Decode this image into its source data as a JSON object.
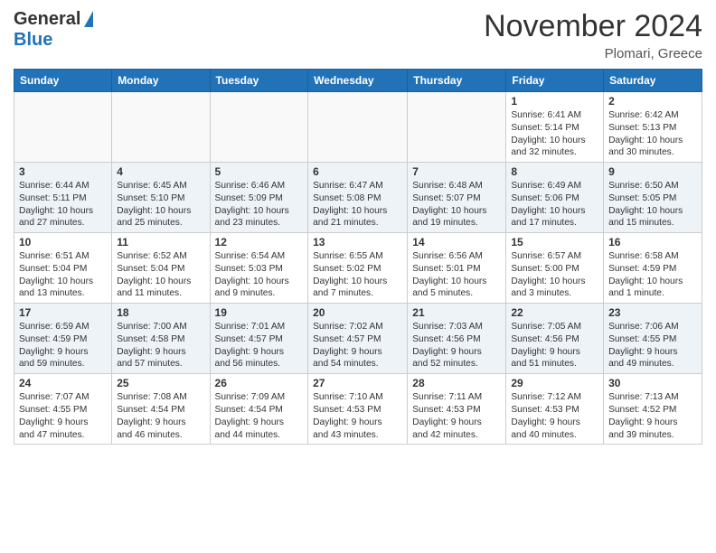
{
  "header": {
    "logo_general": "General",
    "logo_blue": "Blue",
    "month": "November 2024",
    "location": "Plomari, Greece"
  },
  "columns": [
    "Sunday",
    "Monday",
    "Tuesday",
    "Wednesday",
    "Thursday",
    "Friday",
    "Saturday"
  ],
  "rows": [
    [
      {
        "day": "",
        "info": ""
      },
      {
        "day": "",
        "info": ""
      },
      {
        "day": "",
        "info": ""
      },
      {
        "day": "",
        "info": ""
      },
      {
        "day": "",
        "info": ""
      },
      {
        "day": "1",
        "info": "Sunrise: 6:41 AM\nSunset: 5:14 PM\nDaylight: 10 hours\nand 32 minutes."
      },
      {
        "day": "2",
        "info": "Sunrise: 6:42 AM\nSunset: 5:13 PM\nDaylight: 10 hours\nand 30 minutes."
      }
    ],
    [
      {
        "day": "3",
        "info": "Sunrise: 6:44 AM\nSunset: 5:11 PM\nDaylight: 10 hours\nand 27 minutes."
      },
      {
        "day": "4",
        "info": "Sunrise: 6:45 AM\nSunset: 5:10 PM\nDaylight: 10 hours\nand 25 minutes."
      },
      {
        "day": "5",
        "info": "Sunrise: 6:46 AM\nSunset: 5:09 PM\nDaylight: 10 hours\nand 23 minutes."
      },
      {
        "day": "6",
        "info": "Sunrise: 6:47 AM\nSunset: 5:08 PM\nDaylight: 10 hours\nand 21 minutes."
      },
      {
        "day": "7",
        "info": "Sunrise: 6:48 AM\nSunset: 5:07 PM\nDaylight: 10 hours\nand 19 minutes."
      },
      {
        "day": "8",
        "info": "Sunrise: 6:49 AM\nSunset: 5:06 PM\nDaylight: 10 hours\nand 17 minutes."
      },
      {
        "day": "9",
        "info": "Sunrise: 6:50 AM\nSunset: 5:05 PM\nDaylight: 10 hours\nand 15 minutes."
      }
    ],
    [
      {
        "day": "10",
        "info": "Sunrise: 6:51 AM\nSunset: 5:04 PM\nDaylight: 10 hours\nand 13 minutes."
      },
      {
        "day": "11",
        "info": "Sunrise: 6:52 AM\nSunset: 5:04 PM\nDaylight: 10 hours\nand 11 minutes."
      },
      {
        "day": "12",
        "info": "Sunrise: 6:54 AM\nSunset: 5:03 PM\nDaylight: 10 hours\nand 9 minutes."
      },
      {
        "day": "13",
        "info": "Sunrise: 6:55 AM\nSunset: 5:02 PM\nDaylight: 10 hours\nand 7 minutes."
      },
      {
        "day": "14",
        "info": "Sunrise: 6:56 AM\nSunset: 5:01 PM\nDaylight: 10 hours\nand 5 minutes."
      },
      {
        "day": "15",
        "info": "Sunrise: 6:57 AM\nSunset: 5:00 PM\nDaylight: 10 hours\nand 3 minutes."
      },
      {
        "day": "16",
        "info": "Sunrise: 6:58 AM\nSunset: 4:59 PM\nDaylight: 10 hours\nand 1 minute."
      }
    ],
    [
      {
        "day": "17",
        "info": "Sunrise: 6:59 AM\nSunset: 4:59 PM\nDaylight: 9 hours\nand 59 minutes."
      },
      {
        "day": "18",
        "info": "Sunrise: 7:00 AM\nSunset: 4:58 PM\nDaylight: 9 hours\nand 57 minutes."
      },
      {
        "day": "19",
        "info": "Sunrise: 7:01 AM\nSunset: 4:57 PM\nDaylight: 9 hours\nand 56 minutes."
      },
      {
        "day": "20",
        "info": "Sunrise: 7:02 AM\nSunset: 4:57 PM\nDaylight: 9 hours\nand 54 minutes."
      },
      {
        "day": "21",
        "info": "Sunrise: 7:03 AM\nSunset: 4:56 PM\nDaylight: 9 hours\nand 52 minutes."
      },
      {
        "day": "22",
        "info": "Sunrise: 7:05 AM\nSunset: 4:56 PM\nDaylight: 9 hours\nand 51 minutes."
      },
      {
        "day": "23",
        "info": "Sunrise: 7:06 AM\nSunset: 4:55 PM\nDaylight: 9 hours\nand 49 minutes."
      }
    ],
    [
      {
        "day": "24",
        "info": "Sunrise: 7:07 AM\nSunset: 4:55 PM\nDaylight: 9 hours\nand 47 minutes."
      },
      {
        "day": "25",
        "info": "Sunrise: 7:08 AM\nSunset: 4:54 PM\nDaylight: 9 hours\nand 46 minutes."
      },
      {
        "day": "26",
        "info": "Sunrise: 7:09 AM\nSunset: 4:54 PM\nDaylight: 9 hours\nand 44 minutes."
      },
      {
        "day": "27",
        "info": "Sunrise: 7:10 AM\nSunset: 4:53 PM\nDaylight: 9 hours\nand 43 minutes."
      },
      {
        "day": "28",
        "info": "Sunrise: 7:11 AM\nSunset: 4:53 PM\nDaylight: 9 hours\nand 42 minutes."
      },
      {
        "day": "29",
        "info": "Sunrise: 7:12 AM\nSunset: 4:53 PM\nDaylight: 9 hours\nand 40 minutes."
      },
      {
        "day": "30",
        "info": "Sunrise: 7:13 AM\nSunset: 4:52 PM\nDaylight: 9 hours\nand 39 minutes."
      }
    ]
  ]
}
